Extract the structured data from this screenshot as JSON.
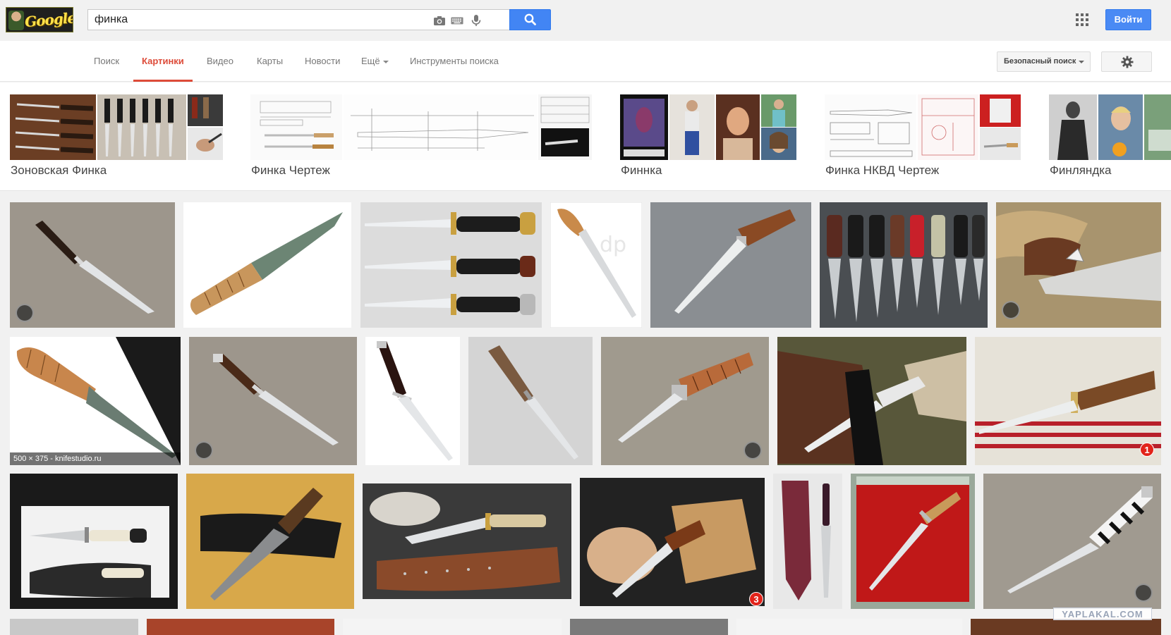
{
  "search": {
    "query": "финка",
    "icons": [
      "camera-icon",
      "keyboard-icon",
      "microphone-icon",
      "search-icon"
    ]
  },
  "header": {
    "logo_text": "Google",
    "signin_label": "Войти",
    "apps_icon": "grid-icon"
  },
  "colors": {
    "accent_blue": "#4285f4",
    "active_tab_red": "#dd4b39",
    "background": "#f1f1f1"
  },
  "nav": {
    "tabs": [
      {
        "label": "Поиск",
        "active": false
      },
      {
        "label": "Картинки",
        "active": true
      },
      {
        "label": "Видео",
        "active": false
      },
      {
        "label": "Карты",
        "active": false
      },
      {
        "label": "Новости",
        "active": false
      },
      {
        "label": "Ещё",
        "active": false,
        "dropdown": true
      },
      {
        "label": "Инструменты поиска",
        "active": false
      }
    ],
    "safe_search_label": "Безопасный поиск",
    "settings_icon": "gear-icon"
  },
  "related": [
    {
      "label": "Зоновская Финка"
    },
    {
      "label": "Финка Чертеж"
    },
    {
      "label": "Финнка"
    },
    {
      "label": "Финка НКВД Чертеж"
    },
    {
      "label": "Финляндка"
    }
  ],
  "results": {
    "caption_hover": "500 × 375 - knifestudio.ru",
    "badges": [
      "1",
      "3"
    ],
    "watermark_text": "YAPLAKAL.COM"
  }
}
